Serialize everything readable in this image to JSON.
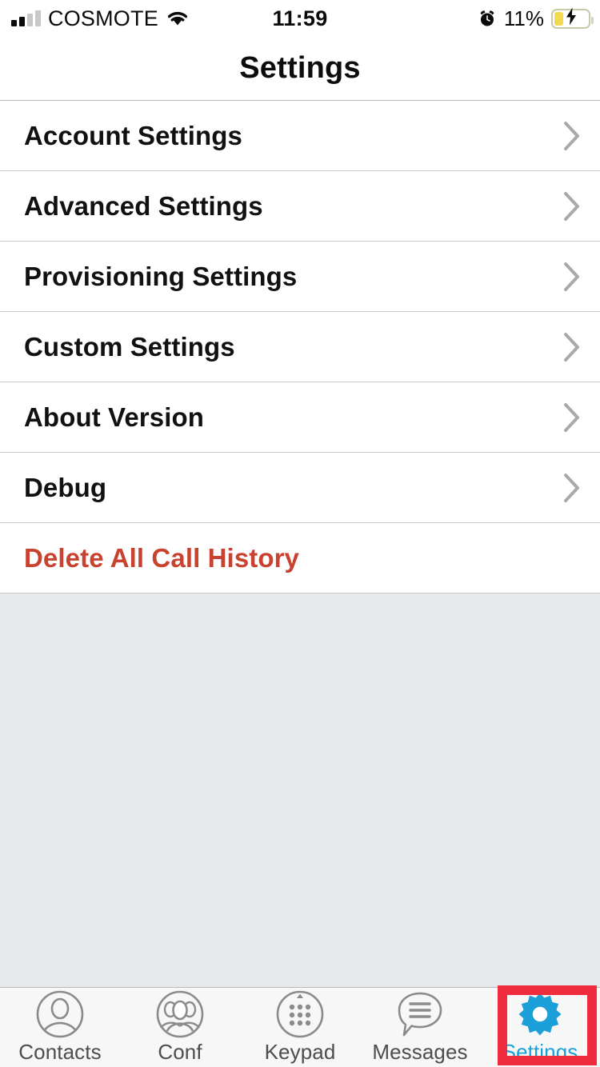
{
  "status_bar": {
    "carrier": "COSMOTE",
    "signal_bars_filled": 2,
    "signal_bars_total": 4,
    "wifi_icon": "wifi-icon",
    "time": "11:59",
    "alarm_icon": "alarm-clock-icon",
    "battery_percent": "11%",
    "battery_level": 11,
    "battery_charging": true,
    "battery_color": "#f2d94e"
  },
  "header": {
    "title": "Settings"
  },
  "list": {
    "items": [
      {
        "label": "Account Settings",
        "chevron": true,
        "style": "normal"
      },
      {
        "label": "Advanced Settings",
        "chevron": true,
        "style": "normal"
      },
      {
        "label": "Provisioning Settings",
        "chevron": true,
        "style": "normal"
      },
      {
        "label": "Custom Settings",
        "chevron": true,
        "style": "normal"
      },
      {
        "label": "About Version",
        "chevron": true,
        "style": "normal"
      },
      {
        "label": "Debug",
        "chevron": true,
        "style": "normal"
      },
      {
        "label": "Delete All Call History",
        "chevron": false,
        "style": "danger"
      }
    ],
    "danger_color": "#c9412f"
  },
  "tab_bar": {
    "active_index": 4,
    "active_color": "#1b9fd8",
    "inactive_color": "#4d4d4d",
    "tabs": [
      {
        "label": "Contacts",
        "icon": "contact-person-icon"
      },
      {
        "label": "Conf",
        "icon": "conference-group-icon"
      },
      {
        "label": "Keypad",
        "icon": "dialpad-icon"
      },
      {
        "label": "Messages",
        "icon": "message-bubble-icon"
      },
      {
        "label": "Settings",
        "icon": "gear-icon"
      }
    ]
  },
  "annotation": {
    "highlight_target": "Settings",
    "highlight_color": "#ef2b3e"
  }
}
